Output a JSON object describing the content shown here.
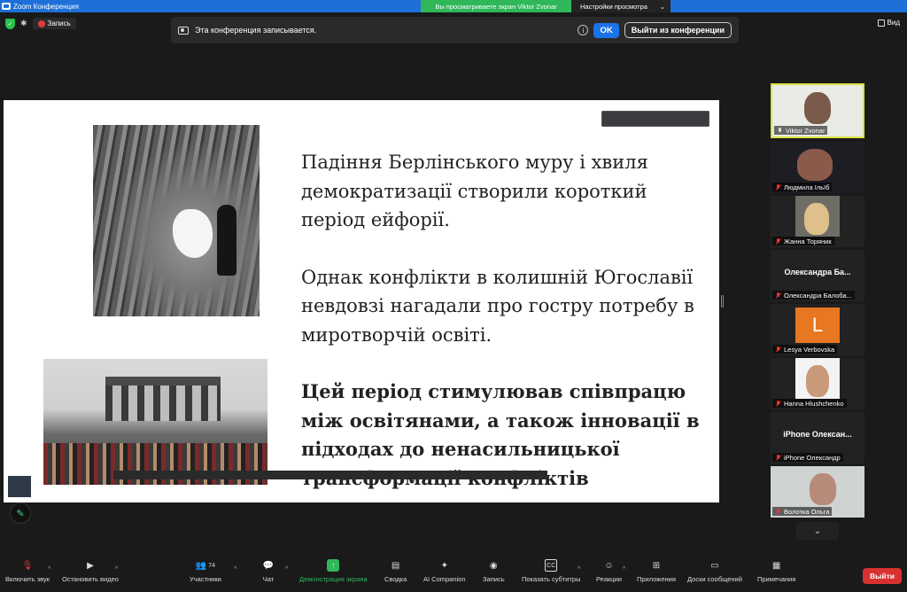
{
  "window": {
    "title": "Zoom Конференция"
  },
  "banner": {
    "share_text": "Вы просматриваете экран Viktor Zvonar",
    "view_settings": "Настройки просмотра"
  },
  "topbar": {
    "record_label": "Запись",
    "view_label": "Вид"
  },
  "recording_notice": {
    "text": "Эта конференция записывается.",
    "ok": "OK",
    "leave": "Выйти из конференции"
  },
  "slide": {
    "paragraphs": [
      "Падіння Берлінського муру і хвиля демократизації створили короткий період ейфорії.",
      "Однак конфлікти в колишній Югославії невдовзі нагадали про гостру потребу в миротворчій освіті.",
      "Цей період стимулював співпрацю між освітянами, а також інновації в підходах до ненасильницької трансформації конфліктів"
    ]
  },
  "participants": [
    {
      "name": "Viktor Zvonar",
      "type": "video",
      "muted": false,
      "active": true
    },
    {
      "name": "Людмила Ільїб",
      "type": "video",
      "muted": true,
      "active": false
    },
    {
      "name": "Жанна Торяник",
      "type": "video",
      "muted": true,
      "active": false
    },
    {
      "name": "Олександра Балоба...",
      "display": "Олександра Ба...",
      "type": "name",
      "muted": true,
      "active": false
    },
    {
      "name": "Lesya Verbovska",
      "initial": "L",
      "type": "avatar",
      "muted": true,
      "active": false
    },
    {
      "name": "Hanna Hlushchenko",
      "type": "video",
      "muted": true,
      "active": false
    },
    {
      "name": "iPhone Олександр",
      "display": "iPhone Олексан...",
      "type": "name",
      "muted": true,
      "active": false
    },
    {
      "name": "Волотка Ольга",
      "type": "video",
      "muted": true,
      "active": false
    }
  ],
  "toolbar": {
    "unmute": "Включить звук",
    "start_video": "Остановить видео",
    "participants": "Участники",
    "participants_count": "74",
    "chat": "Чат",
    "share": "Демонстрация экрана",
    "summary": "Сводка",
    "ai": "AI Companion",
    "record": "Запись",
    "captions": "Показать субтитры",
    "reactions": "Реакции",
    "apps": "Приложения",
    "whiteboards": "Доски сообщений",
    "notes": "Примечания",
    "leave": "Выйти"
  },
  "colors": {
    "accent": "#1a73e8",
    "share_green": "#2fb75a",
    "leave_red": "#d93030",
    "active_speaker": "#d7e341"
  }
}
